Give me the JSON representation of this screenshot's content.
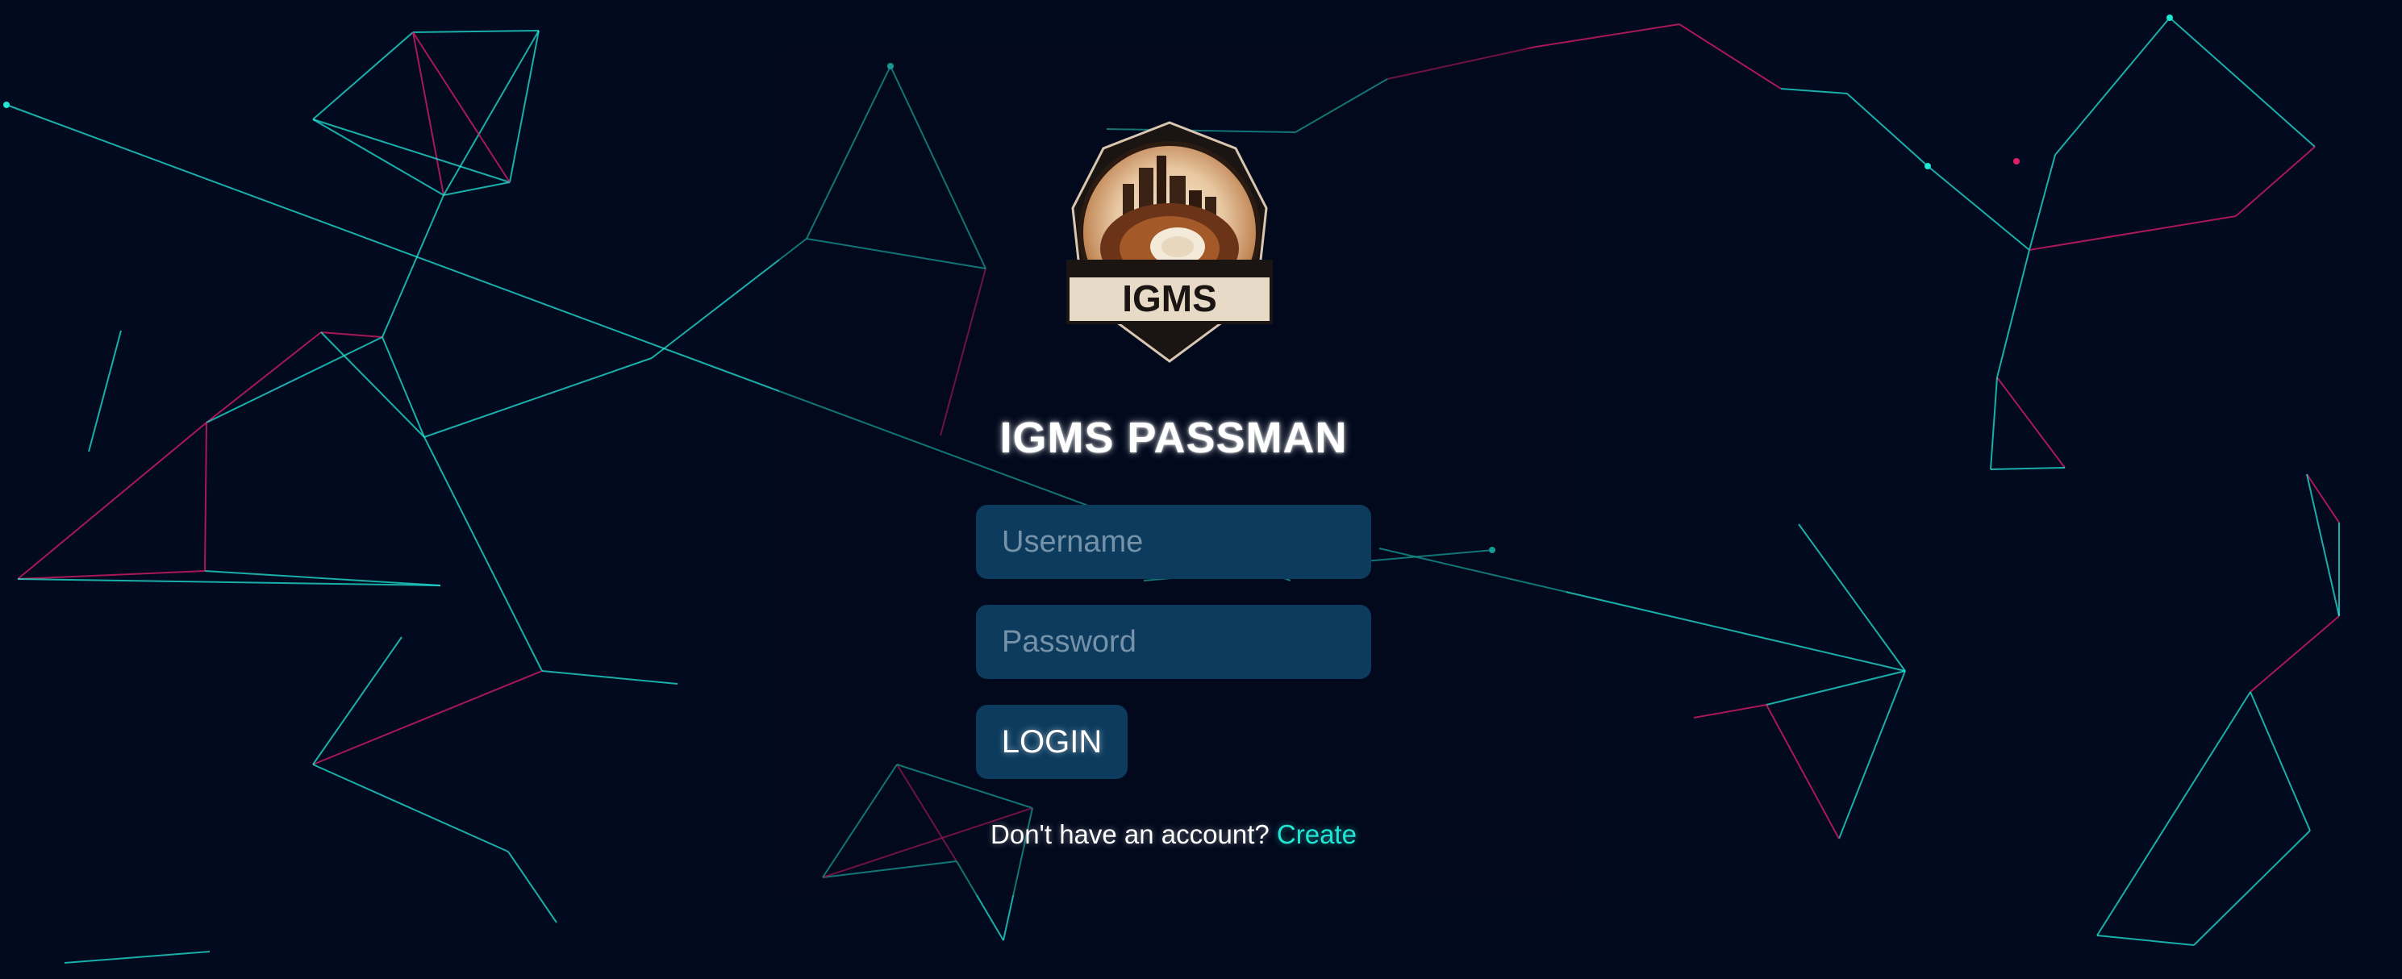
{
  "app": {
    "logo_text": "IGMS",
    "title": "IGMS PASSMAN"
  },
  "form": {
    "username_placeholder": "Username",
    "username_value": "",
    "password_placeholder": "Password",
    "password_value": "",
    "login_label": "LOGIN"
  },
  "signup": {
    "prompt": "Don't have an account?",
    "link_label": "Create"
  },
  "colors": {
    "background": "#020a20",
    "input_bg": "#0c3b5e",
    "accent_cyan": "#21e6d4",
    "accent_pink": "#e01e6a"
  }
}
